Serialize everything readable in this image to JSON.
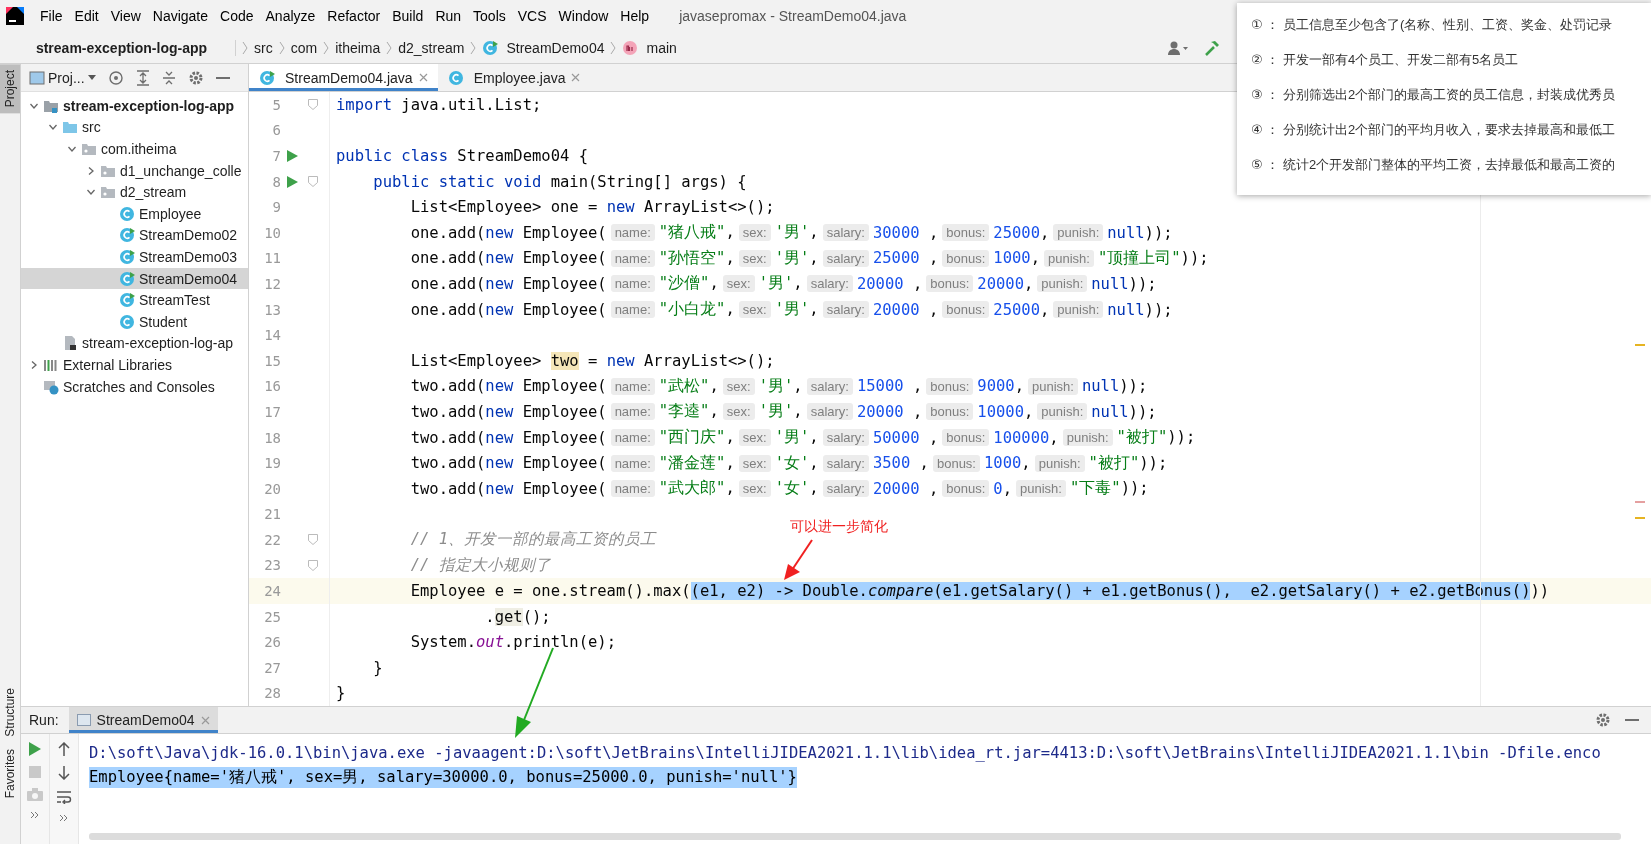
{
  "window": {
    "title": "javasepromax - StreamDemo04.java"
  },
  "menu": [
    "File",
    "Edit",
    "View",
    "Navigate",
    "Code",
    "Analyze",
    "Refactor",
    "Build",
    "Run",
    "Tools",
    "VCS",
    "Window",
    "Help"
  ],
  "breadcrumbs": [
    {
      "label": "stream-exception-log-app",
      "kind": "project"
    },
    {
      "label": "src",
      "kind": "folder"
    },
    {
      "label": "com",
      "kind": "folder"
    },
    {
      "label": "itheima",
      "kind": "folder"
    },
    {
      "label": "d2_stream",
      "kind": "folder"
    },
    {
      "label": "StreamDemo04",
      "kind": "class"
    },
    {
      "label": "main",
      "kind": "method"
    }
  ],
  "tool_strip": [
    {
      "label": "Project",
      "selected": true
    },
    {
      "label": "Structure",
      "selected": false
    },
    {
      "label": "Favorites",
      "selected": false
    }
  ],
  "project_panel": {
    "title": "Proj...",
    "tree": [
      {
        "label": "stream-exception-log-app",
        "kind": "module",
        "expanded": true,
        "selected": false,
        "children": [
          {
            "label": "src",
            "kind": "source-folder",
            "expanded": true,
            "selected": false,
            "children": [
              {
                "label": "com.itheima",
                "kind": "package",
                "expanded": true,
                "selected": false,
                "children": [
                  {
                    "label": "d1_unchange_colle",
                    "kind": "package",
                    "expanded": false,
                    "selected": false
                  },
                  {
                    "label": "d2_stream",
                    "kind": "package",
                    "expanded": true,
                    "selected": false,
                    "children": [
                      {
                        "label": "Employee",
                        "kind": "class",
                        "selected": false
                      },
                      {
                        "label": "StreamDemo02",
                        "kind": "runnable-class",
                        "selected": false
                      },
                      {
                        "label": "StreamDemo03",
                        "kind": "runnable-class",
                        "selected": false
                      },
                      {
                        "label": "StreamDemo04",
                        "kind": "runnable-class",
                        "selected": true
                      },
                      {
                        "label": "StreamTest",
                        "kind": "runnable-class",
                        "selected": false
                      },
                      {
                        "label": "Student",
                        "kind": "class",
                        "selected": false
                      }
                    ]
                  }
                ]
              }
            ]
          },
          {
            "label": "stream-exception-log-ap",
            "kind": "module-file",
            "selected": false
          }
        ]
      },
      {
        "label": "External Libraries",
        "kind": "libraries",
        "expanded": false,
        "selected": false
      },
      {
        "label": "Scratches and Consoles",
        "kind": "scratches",
        "selected": false
      }
    ]
  },
  "editor_tabs": [
    {
      "label": "StreamDemo04.java",
      "kind": "runnable-class",
      "selected": true
    },
    {
      "label": "Employee.java",
      "kind": "class",
      "selected": false
    }
  ],
  "code_lines": [
    {
      "number": "5",
      "current": false,
      "fold": true,
      "run": false,
      "tokens": [
        {
          "kind": "kw",
          "text": "import"
        },
        {
          "kind": "code",
          "text": " java.util.List;"
        }
      ]
    },
    {
      "number": "6",
      "current": false,
      "fold": false,
      "run": false
    },
    {
      "number": "7",
      "current": false,
      "fold": false,
      "run": true,
      "tokens": [
        {
          "kind": "kw",
          "text": "public class"
        },
        {
          "kind": "code",
          "text": " StreamDemo04 {"
        }
      ]
    },
    {
      "number": "8",
      "current": false,
      "fold": true,
      "run": true,
      "tokens": [
        {
          "kind": "kw",
          "text": "    public static void"
        },
        {
          "kind": "code",
          "text": " main(String[] args) {"
        }
      ]
    },
    {
      "number": "9",
      "current": false,
      "fold": false,
      "run": false,
      "tokens": [
        {
          "kind": "code",
          "text": "        List<Employee> one = "
        },
        {
          "kind": "kw",
          "text": "new"
        },
        {
          "kind": "code",
          "text": " ArrayList<>();"
        }
      ]
    },
    {
      "number": "10",
      "current": false,
      "fold": false,
      "run": false,
      "tokens": [
        {
          "kind": "code",
          "text": "        one.add("
        },
        {
          "kind": "kw",
          "text": "new"
        },
        {
          "kind": "code",
          "text": " Employee("
        },
        {
          "kind": "hint",
          "text": "name:"
        },
        {
          "kind": "str",
          "text": "\"猪八戒\""
        },
        {
          "kind": "code",
          "text": ","
        },
        {
          "kind": "hint",
          "text": "sex:"
        },
        {
          "kind": "str",
          "text": "'男'"
        },
        {
          "kind": "code",
          "text": ","
        },
        {
          "kind": "hint",
          "text": "salary:"
        },
        {
          "kind": "num",
          "text": "30000"
        },
        {
          "kind": "code",
          "text": " ,"
        },
        {
          "kind": "hint",
          "text": "bonus:"
        },
        {
          "kind": "num",
          "text": "25000"
        },
        {
          "kind": "code",
          "text": ","
        },
        {
          "kind": "hint",
          "text": "punish:"
        },
        {
          "kind": "kw",
          "text": "null"
        },
        {
          "kind": "code",
          "text": "));"
        }
      ]
    },
    {
      "number": "11",
      "current": false,
      "fold": false,
      "run": false,
      "tokens": [
        {
          "kind": "code",
          "text": "        one.add("
        },
        {
          "kind": "kw",
          "text": "new"
        },
        {
          "kind": "code",
          "text": " Employee("
        },
        {
          "kind": "hint",
          "text": "name:"
        },
        {
          "kind": "str",
          "text": "\"孙悟空\""
        },
        {
          "kind": "code",
          "text": ","
        },
        {
          "kind": "hint",
          "text": "sex:"
        },
        {
          "kind": "str",
          "text": "'男'"
        },
        {
          "kind": "code",
          "text": ","
        },
        {
          "kind": "hint",
          "text": "salary:"
        },
        {
          "kind": "num",
          "text": "25000"
        },
        {
          "kind": "code",
          "text": " ,"
        },
        {
          "kind": "hint",
          "text": "bonus:"
        },
        {
          "kind": "num",
          "text": "1000"
        },
        {
          "kind": "code",
          "text": ","
        },
        {
          "kind": "hint",
          "text": "punish:"
        },
        {
          "kind": "str",
          "text": "\"顶撞上司\""
        },
        {
          "kind": "code",
          "text": "));"
        }
      ]
    },
    {
      "number": "12",
      "current": false,
      "fold": false,
      "run": false,
      "tokens": [
        {
          "kind": "code",
          "text": "        one.add("
        },
        {
          "kind": "kw",
          "text": "new"
        },
        {
          "kind": "code",
          "text": " Employee("
        },
        {
          "kind": "hint",
          "text": "name:"
        },
        {
          "kind": "str",
          "text": "\"沙僧\""
        },
        {
          "kind": "code",
          "text": ","
        },
        {
          "kind": "hint",
          "text": "sex:"
        },
        {
          "kind": "str",
          "text": "'男'"
        },
        {
          "kind": "code",
          "text": ","
        },
        {
          "kind": "hint",
          "text": "salary:"
        },
        {
          "kind": "num",
          "text": "20000"
        },
        {
          "kind": "code",
          "text": " ,"
        },
        {
          "kind": "hint",
          "text": "bonus:"
        },
        {
          "kind": "num",
          "text": "20000"
        },
        {
          "kind": "code",
          "text": ","
        },
        {
          "kind": "hint",
          "text": "punish:"
        },
        {
          "kind": "kw",
          "text": "null"
        },
        {
          "kind": "code",
          "text": "));"
        }
      ]
    },
    {
      "number": "13",
      "current": false,
      "fold": false,
      "run": false,
      "tokens": [
        {
          "kind": "code",
          "text": "        one.add("
        },
        {
          "kind": "kw",
          "text": "new"
        },
        {
          "kind": "code",
          "text": " Employee("
        },
        {
          "kind": "hint",
          "text": "name:"
        },
        {
          "kind": "str",
          "text": "\"小白龙\""
        },
        {
          "kind": "code",
          "text": ","
        },
        {
          "kind": "hint",
          "text": "sex:"
        },
        {
          "kind": "str",
          "text": "'男'"
        },
        {
          "kind": "code",
          "text": ","
        },
        {
          "kind": "hint",
          "text": "salary:"
        },
        {
          "kind": "num",
          "text": "20000"
        },
        {
          "kind": "code",
          "text": " ,"
        },
        {
          "kind": "hint",
          "text": "bonus:"
        },
        {
          "kind": "num",
          "text": "25000"
        },
        {
          "kind": "code",
          "text": ","
        },
        {
          "kind": "hint",
          "text": "punish:"
        },
        {
          "kind": "kw",
          "text": "null"
        },
        {
          "kind": "code",
          "text": "));"
        }
      ]
    },
    {
      "number": "14",
      "current": false,
      "fold": false,
      "run": false
    },
    {
      "number": "15",
      "current": false,
      "fold": false,
      "run": false,
      "tokens": [
        {
          "kind": "code",
          "text": "        List<Employee> "
        },
        {
          "kind": "usage",
          "text": "two"
        },
        {
          "kind": "code",
          "text": " = "
        },
        {
          "kind": "kw",
          "text": "new"
        },
        {
          "kind": "code",
          "text": " ArrayList<>();"
        }
      ]
    },
    {
      "number": "16",
      "current": false,
      "fold": false,
      "run": false,
      "tokens": [
        {
          "kind": "code",
          "text": "        two.add("
        },
        {
          "kind": "kw",
          "text": "new"
        },
        {
          "kind": "code",
          "text": " Employee("
        },
        {
          "kind": "hint",
          "text": "name:"
        },
        {
          "kind": "str",
          "text": "\"武松\""
        },
        {
          "kind": "code",
          "text": ","
        },
        {
          "kind": "hint",
          "text": "sex:"
        },
        {
          "kind": "str",
          "text": "'男'"
        },
        {
          "kind": "code",
          "text": ","
        },
        {
          "kind": "hint",
          "text": "salary:"
        },
        {
          "kind": "num",
          "text": "15000"
        },
        {
          "kind": "code",
          "text": " ,"
        },
        {
          "kind": "hint",
          "text": "bonus:"
        },
        {
          "kind": "num",
          "text": "9000"
        },
        {
          "kind": "code",
          "text": ","
        },
        {
          "kind": "hint",
          "text": "punish:"
        },
        {
          "kind": "kw",
          "text": "null"
        },
        {
          "kind": "code",
          "text": "));"
        }
      ]
    },
    {
      "number": "17",
      "current": false,
      "fold": false,
      "run": false,
      "tokens": [
        {
          "kind": "code",
          "text": "        two.add("
        },
        {
          "kind": "kw",
          "text": "new"
        },
        {
          "kind": "code",
          "text": " Employee("
        },
        {
          "kind": "hint",
          "text": "name:"
        },
        {
          "kind": "str",
          "text": "\"李逵\""
        },
        {
          "kind": "code",
          "text": ","
        },
        {
          "kind": "hint",
          "text": "sex:"
        },
        {
          "kind": "str",
          "text": "'男'"
        },
        {
          "kind": "code",
          "text": ","
        },
        {
          "kind": "hint",
          "text": "salary:"
        },
        {
          "kind": "num",
          "text": "20000"
        },
        {
          "kind": "code",
          "text": " ,"
        },
        {
          "kind": "hint",
          "text": "bonus:"
        },
        {
          "kind": "num",
          "text": "10000"
        },
        {
          "kind": "code",
          "text": ","
        },
        {
          "kind": "hint",
          "text": "punish:"
        },
        {
          "kind": "kw",
          "text": "null"
        },
        {
          "kind": "code",
          "text": "));"
        }
      ]
    },
    {
      "number": "18",
      "current": false,
      "fold": false,
      "run": false,
      "tokens": [
        {
          "kind": "code",
          "text": "        two.add("
        },
        {
          "kind": "kw",
          "text": "new"
        },
        {
          "kind": "code",
          "text": " Employee("
        },
        {
          "kind": "hint",
          "text": "name:"
        },
        {
          "kind": "str",
          "text": "\"西门庆\""
        },
        {
          "kind": "code",
          "text": ","
        },
        {
          "kind": "hint",
          "text": "sex:"
        },
        {
          "kind": "str",
          "text": "'男'"
        },
        {
          "kind": "code",
          "text": ","
        },
        {
          "kind": "hint",
          "text": "salary:"
        },
        {
          "kind": "num",
          "text": "50000"
        },
        {
          "kind": "code",
          "text": " ,"
        },
        {
          "kind": "hint",
          "text": "bonus:"
        },
        {
          "kind": "num",
          "text": "100000"
        },
        {
          "kind": "code",
          "text": ","
        },
        {
          "kind": "hint",
          "text": "punish:"
        },
        {
          "kind": "str",
          "text": "\"被打\""
        },
        {
          "kind": "code",
          "text": "));"
        }
      ]
    },
    {
      "number": "19",
      "current": false,
      "fold": false,
      "run": false,
      "tokens": [
        {
          "kind": "code",
          "text": "        two.add("
        },
        {
          "kind": "kw",
          "text": "new"
        },
        {
          "kind": "code",
          "text": " Employee("
        },
        {
          "kind": "hint",
          "text": "name:"
        },
        {
          "kind": "str",
          "text": "\"潘金莲\""
        },
        {
          "kind": "code",
          "text": ","
        },
        {
          "kind": "hint",
          "text": "sex:"
        },
        {
          "kind": "str",
          "text": "'女'"
        },
        {
          "kind": "code",
          "text": ","
        },
        {
          "kind": "hint",
          "text": "salary:"
        },
        {
          "kind": "num",
          "text": "3500"
        },
        {
          "kind": "code",
          "text": " ,"
        },
        {
          "kind": "hint",
          "text": "bonus:"
        },
        {
          "kind": "num",
          "text": "1000"
        },
        {
          "kind": "code",
          "text": ","
        },
        {
          "kind": "hint",
          "text": "punish:"
        },
        {
          "kind": "str",
          "text": "\"被打\""
        },
        {
          "kind": "code",
          "text": "));"
        }
      ]
    },
    {
      "number": "20",
      "current": false,
      "fold": false,
      "run": false,
      "tokens": [
        {
          "kind": "code",
          "text": "        two.add("
        },
        {
          "kind": "kw",
          "text": "new"
        },
        {
          "kind": "code",
          "text": " Employee("
        },
        {
          "kind": "hint",
          "text": "name:"
        },
        {
          "kind": "str",
          "text": "\"武大郎\""
        },
        {
          "kind": "code",
          "text": ","
        },
        {
          "kind": "hint",
          "text": "sex:"
        },
        {
          "kind": "str",
          "text": "'女'"
        },
        {
          "kind": "code",
          "text": ","
        },
        {
          "kind": "hint",
          "text": "salary:"
        },
        {
          "kind": "num",
          "text": "20000"
        },
        {
          "kind": "code",
          "text": " ,"
        },
        {
          "kind": "hint",
          "text": "bonus:"
        },
        {
          "kind": "num",
          "text": "0"
        },
        {
          "kind": "code",
          "text": ","
        },
        {
          "kind": "hint",
          "text": "punish:"
        },
        {
          "kind": "str",
          "text": "\"下毒\""
        },
        {
          "kind": "code",
          "text": "));"
        }
      ]
    },
    {
      "number": "21",
      "current": false,
      "fold": false,
      "run": false
    },
    {
      "number": "22",
      "current": false,
      "fold": true,
      "run": false,
      "tokens": [
        {
          "kind": "comment",
          "text": "        // 1、开发一部的最高工资的员工"
        }
      ]
    },
    {
      "number": "23",
      "current": false,
      "fold": true,
      "run": false,
      "tokens": [
        {
          "kind": "comment",
          "text": "        // 指定大小规则了"
        }
      ]
    },
    {
      "number": "24",
      "current": true,
      "fold": false,
      "run": false,
      "tokens": [
        {
          "kind": "code",
          "text": "        Employee e = one.stream().max("
        },
        {
          "kind": "selected",
          "text": "(e1, e2) -> Double."
        },
        {
          "kind": "selected-static",
          "text": "compare"
        },
        {
          "kind": "selected",
          "text": "(e1.getSalary() + e1.getBonus(),  e2.getSalary() + e2.getBonus()"
        },
        {
          "kind": "code",
          "text": "))"
        }
      ]
    },
    {
      "number": "25",
      "current": false,
      "fold": false,
      "run": false,
      "tokens": [
        {
          "kind": "code",
          "text": "                ."
        },
        {
          "kind": "usage-light",
          "text": "get"
        },
        {
          "kind": "code",
          "text": "();"
        }
      ]
    },
    {
      "number": "26",
      "current": false,
      "fold": false,
      "run": false,
      "tokens": [
        {
          "kind": "code",
          "text": "        System."
        },
        {
          "kind": "static",
          "text": "out"
        },
        {
          "kind": "code",
          "text": ".println(e);"
        }
      ]
    },
    {
      "number": "27",
      "current": false,
      "fold": false,
      "run": false,
      "tokens": [
        {
          "kind": "code",
          "text": "    }"
        }
      ]
    },
    {
      "number": "28",
      "current": false,
      "fold": false,
      "run": false,
      "tokens": [
        {
          "kind": "code",
          "text": "}"
        }
      ]
    }
  ],
  "annotation": {
    "text": "可以进一步简化"
  },
  "notes_popup": {
    "items": [
      "① ： 员工信息至少包含了(名称、性别、工资、奖金、处罚记录",
      "② ： 开发一部有4个员工、开发二部有5名员工",
      "③ ： 分别筛选出2个部门的最高工资的员工信息，封装成优秀员",
      "④ ： 分别统计出2个部门的平均月收入，要求去掉最高和最低工",
      "⑤ ： 统计2个开发部门整体的平均工资，去掉最低和最高工资的"
    ]
  },
  "run_panel": {
    "label": "Run:",
    "tabs": [
      {
        "label": "StreamDemo04",
        "selected": true
      }
    ],
    "console": [
      {
        "kind": "command",
        "selected": false,
        "text": "D:\\soft\\Java\\jdk-16.0.1\\bin\\java.exe -javaagent:D:\\soft\\JetBrains\\IntelliJIDEA2021.1.1\\lib\\idea_rt.jar=4413:D:\\soft\\JetBrains\\IntelliJIDEA2021.1.1\\bin -Dfile.enco"
      },
      {
        "kind": "output",
        "selected": true,
        "text": "Employee{name='猪八戒', sex=男, salary=30000.0, bonus=25000.0, punish='null'}"
      }
    ]
  }
}
